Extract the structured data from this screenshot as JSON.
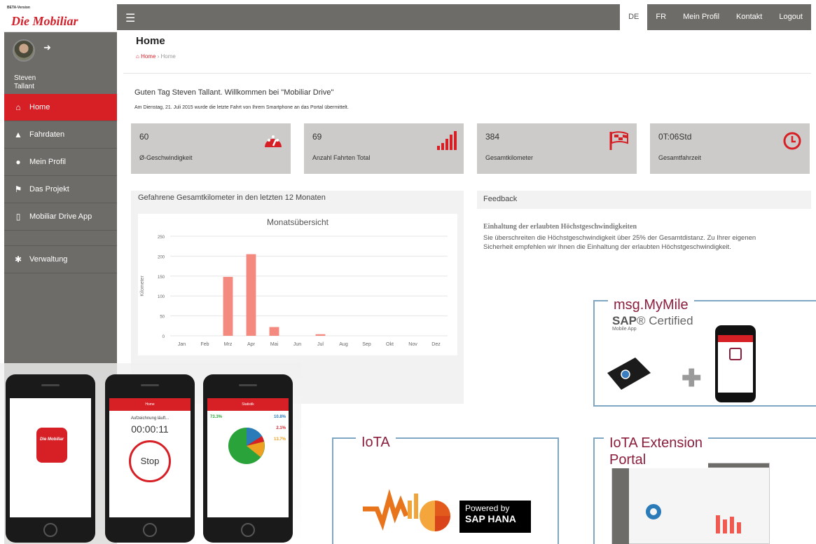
{
  "sidebar": {
    "beta_label": "BETA-Version",
    "logo_text": "Die Mobiliar",
    "user": {
      "name_line1": "Steven",
      "name_line2": "Tallant"
    },
    "items": [
      {
        "label": "Home",
        "icon": "home-icon"
      },
      {
        "label": "Fahrdaten",
        "icon": "road-icon"
      },
      {
        "label": "Mein Profil",
        "icon": "user-icon"
      },
      {
        "label": "Das Projekt",
        "icon": "flag-icon"
      },
      {
        "label": "Mobiliar Drive App",
        "icon": "mobile-icon"
      },
      {
        "label": "Verwaltung",
        "icon": "gear-icon"
      }
    ]
  },
  "topnav": {
    "de": "DE",
    "fr": "FR",
    "profile": "Mein Profil",
    "contact": "Kontakt",
    "logout": "Logout"
  },
  "header": {
    "title": "Home",
    "breadcrumb_home": "Home",
    "breadcrumb_current": "Home"
  },
  "welcome": "Guten Tag Steven Tallant. Willkommen bei \"Mobiliar Drive\"",
  "last_ride": "Am Dienstag, 21. Juli 2015 wurde die letzte Fahrt von Ihrem Smartphone an das Portal übermittelt.",
  "stats": [
    {
      "value": "60",
      "label": "Ø-Geschwindigkeit",
      "icon": "speedometer-icon"
    },
    {
      "value": "69",
      "label": "Anzahl Fahrten Total",
      "icon": "signal-bars-icon"
    },
    {
      "value": "384",
      "label": "Gesamtkilometer",
      "icon": "checkered-flag-icon"
    },
    {
      "value": "0T:06Std",
      "label": "Gesamtfahrzeit",
      "icon": "clock-icon"
    }
  ],
  "chart_panel_title": "Gefahrene Gesamtkilometer in den letzten 12 Monaten",
  "chart_data": {
    "type": "bar",
    "title": "Monatsübersicht",
    "ylabel": "Kilometer",
    "ylim": [
      0,
      250
    ],
    "yticks": [
      0,
      50,
      100,
      150,
      200,
      250
    ],
    "categories": [
      "Jan",
      "Feb",
      "Mrz",
      "Apr",
      "Mai",
      "Jun",
      "Jul",
      "Aug",
      "Sep",
      "Okt",
      "Nov",
      "Dez"
    ],
    "values": [
      0,
      0,
      148,
      205,
      22,
      0,
      4,
      0,
      0,
      0,
      0,
      0
    ],
    "color": "#f4897f",
    "grid": true
  },
  "feedback": {
    "title": "Feedback",
    "heading": "Einhaltung der erlaubten Höchstgeschwindigkeiten",
    "text": "Sie überschreiten die Höchstgeschwindigkeit über 25% der Gesamtdistanz. Zu Ihrer eigenen Sicherheit empfehlen wir Ihnen die Einhaltung der erlaubten Höchstgeschwindigkeit."
  },
  "promos": {
    "mymile_title": "msg.MyMile",
    "sap_certified_sap": "SAP",
    "sap_certified_word": "Certified",
    "sap_certified_sub": "Mobile App",
    "iota_title": "IoTA",
    "iota_powered1": "Powered by",
    "iota_powered2": "SAP HANA",
    "ext_title_line1": "IoTA Extension",
    "ext_title_line2": "Portal"
  },
  "phones": {
    "stop_app_header": "Home",
    "stop_recording": "Aufzeichnung läuft...",
    "stop_timer": "00:00:11",
    "stop_button": "Stop",
    "stats_app_header": "Statistik",
    "stats_values": [
      "73.3%",
      "10.8%",
      "2.1%",
      "13.7%"
    ],
    "app_logo": "Die Mobiliar"
  },
  "colors": {
    "brand_red": "#d71f26",
    "sidebar_gray": "#6e6c68",
    "card_gray": "#cccbc9",
    "bar": "#f4897f",
    "promo_title": "#8a1e3c",
    "promo_border": "#7fa6c3"
  }
}
